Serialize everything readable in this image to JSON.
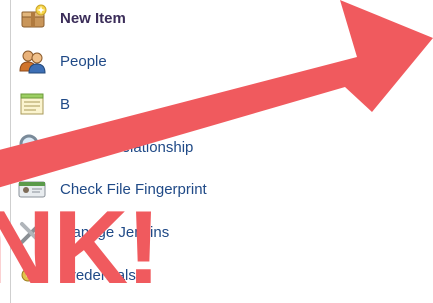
{
  "sidebar": {
    "items": [
      {
        "label": "New Item",
        "icon": "new-item-icon"
      },
      {
        "label": "People",
        "icon": "people-icon"
      },
      {
        "label": "B",
        "icon": "notepad-icon"
      },
      {
        "label": "Project Relationship",
        "icon": "magnifier-icon"
      },
      {
        "label": "Check File Fingerprint",
        "icon": "fingerprint-card-icon"
      },
      {
        "label": "Manage Jenkins",
        "icon": "tools-icon"
      },
      {
        "label": "Credentials",
        "icon": "credentials-icon"
      }
    ]
  },
  "overlay": {
    "big_text": "NK!",
    "color": "#f05a5e"
  }
}
